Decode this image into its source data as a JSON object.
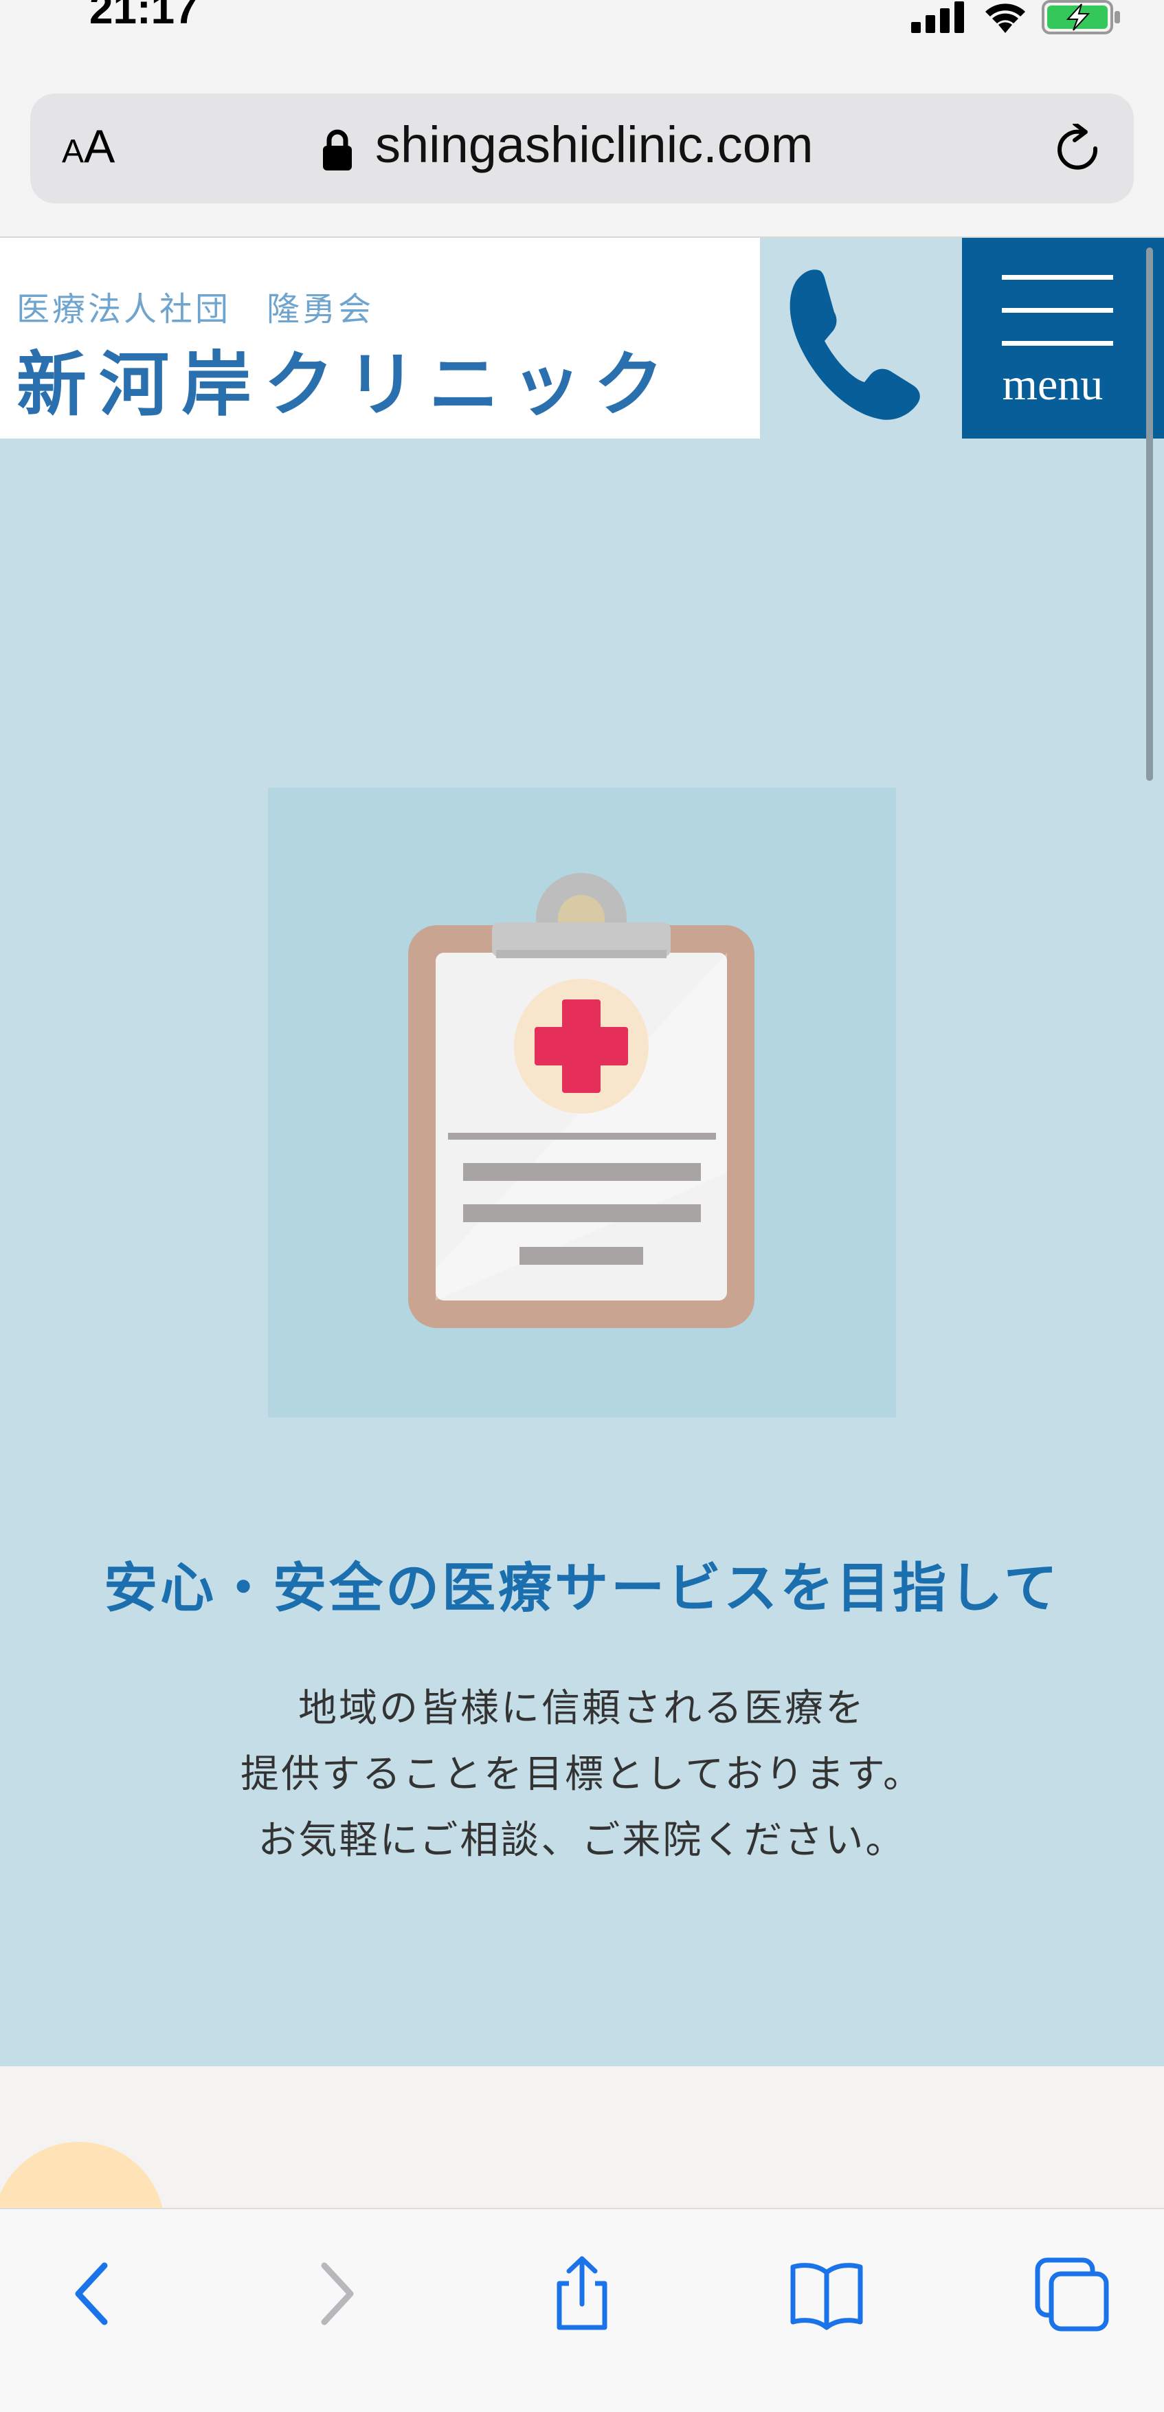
{
  "status_bar": {
    "time": "21:17",
    "icons": [
      "cellular-signal-icon",
      "wifi-icon",
      "battery-charging-icon"
    ],
    "battery_color": "#34c759"
  },
  "browser": {
    "text_size_button": {
      "small": "A",
      "large": "A"
    },
    "url": "shingashiclinic.com",
    "icons": [
      "lock-icon",
      "reload-icon"
    ]
  },
  "header": {
    "logo_subtitle": "医療法人社団　隆勇会",
    "logo_title": "新河岸クリニック",
    "phone_icon": "phone-icon",
    "menu_label": "menu",
    "brand_color": "#085e99"
  },
  "hero": {
    "illustration": "clipboard-medical-icon",
    "heading": "安心・安全の医療サービスを目指して",
    "body_lines": [
      "地域の皆様に信頼される医療を",
      "提供することを目標としております。",
      "お気軽にご相談、ご来院ください。"
    ],
    "accent_color": "#1b6fae"
  },
  "toolbar": {
    "items": [
      "back-icon",
      "forward-icon",
      "share-icon",
      "bookmarks-icon",
      "tabs-icon"
    ]
  }
}
